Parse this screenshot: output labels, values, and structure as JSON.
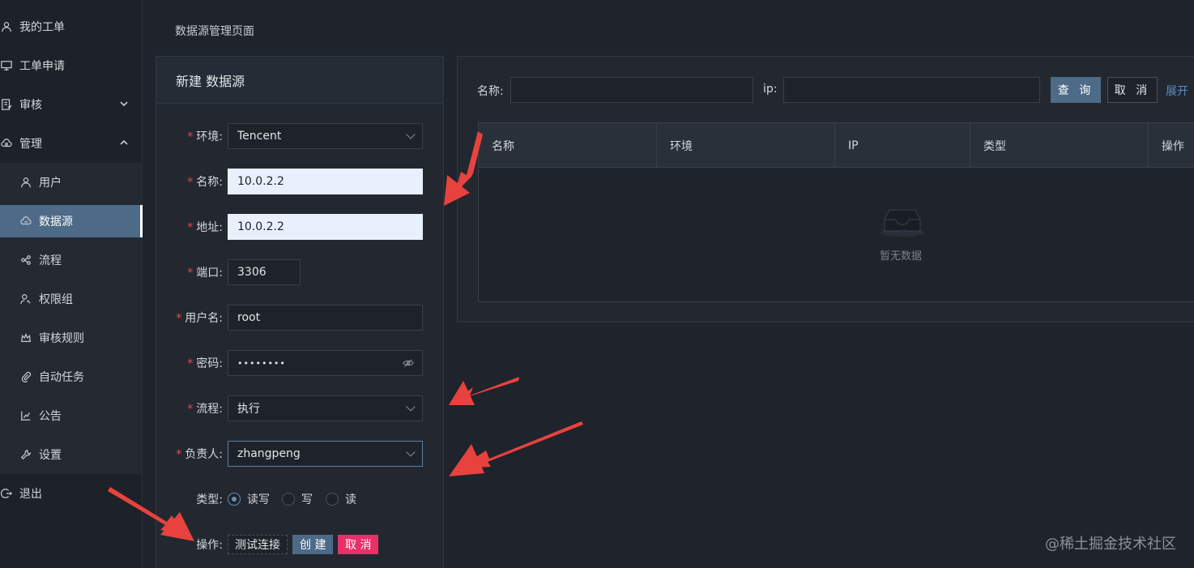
{
  "sidebar": {
    "items": [
      {
        "label": "我的工单",
        "icon": "user-icon",
        "chevron": ""
      },
      {
        "label": "工单申请",
        "icon": "monitor-icon",
        "chevron": ""
      },
      {
        "label": "审核",
        "icon": "audit-icon",
        "chevron": "v"
      },
      {
        "label": "管理",
        "icon": "cloud-gear-icon",
        "chevron": "^"
      }
    ],
    "subitems": [
      {
        "label": "用户",
        "icon": "user-icon"
      },
      {
        "label": "数据源",
        "icon": "database-icon",
        "active": true
      },
      {
        "label": "流程",
        "icon": "flow-icon"
      },
      {
        "label": "权限组",
        "icon": "permission-icon"
      },
      {
        "label": "审核规则",
        "icon": "crown-icon"
      },
      {
        "label": "自动任务",
        "icon": "paperclip-icon"
      },
      {
        "label": "公告",
        "icon": "chart-icon"
      },
      {
        "label": "设置",
        "icon": "wrench-icon"
      }
    ],
    "logout": {
      "label": "退出",
      "icon": "logout-icon"
    }
  },
  "header": {
    "subtitle": "数据源管理页面"
  },
  "form": {
    "title": "新建 数据源",
    "env": {
      "label": "环境:",
      "value": "Tencent"
    },
    "name": {
      "label": "名称:",
      "value": "10.0.2.2"
    },
    "address": {
      "label": "地址:",
      "value": "10.0.2.2"
    },
    "port": {
      "label": "端口:",
      "value": "3306"
    },
    "username": {
      "label": "用户名:",
      "value": "root"
    },
    "password": {
      "label": "密码:",
      "value": "••••••••"
    },
    "flow": {
      "label": "流程:",
      "value": "执行"
    },
    "owner": {
      "label": "负责人:",
      "value": "zhangpeng"
    },
    "type": {
      "label": "类型:",
      "options": [
        "读写",
        "写",
        "读"
      ],
      "selected": "读写"
    },
    "actions": {
      "label": "操作:",
      "test": "测试连接",
      "create": "创 建",
      "cancel": "取 消"
    }
  },
  "search": {
    "name_label": "名称:",
    "ip_label": "ip:",
    "query": "查 询",
    "reset": "取 消",
    "expand": "展开"
  },
  "table": {
    "columns": [
      "名称",
      "环境",
      "IP",
      "类型",
      "操作"
    ],
    "empty_text": "暂无数据"
  },
  "watermark": "@稀土掘金技术社区",
  "colors": {
    "accent": "#4d6a86",
    "danger": "#e8306b",
    "arrow": "#e8423e"
  }
}
